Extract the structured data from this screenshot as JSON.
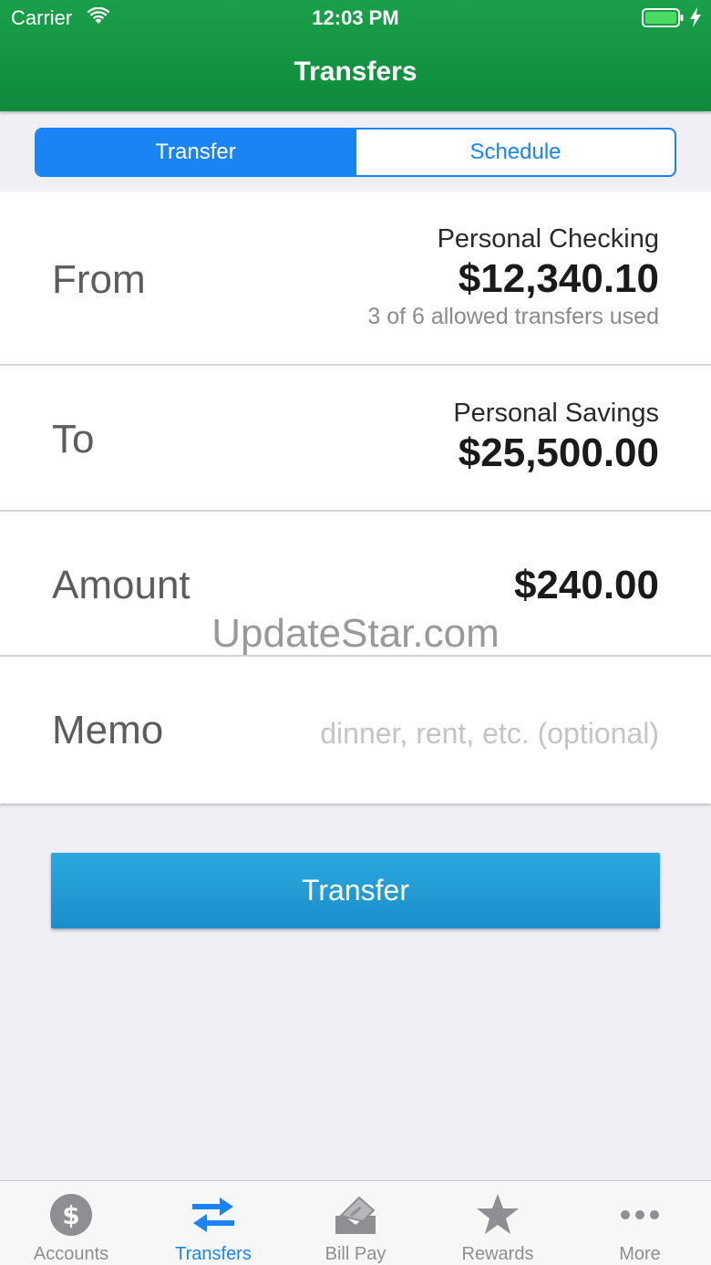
{
  "status_bar": {
    "carrier": "Carrier",
    "time": "12:03 PM"
  },
  "nav": {
    "title": "Transfers"
  },
  "segmented": {
    "transfer": "Transfer",
    "schedule": "Schedule",
    "selected": "Transfer"
  },
  "form": {
    "from": {
      "label": "From",
      "account_name": "Personal Checking",
      "balance": "$12,340.10",
      "note": "3 of 6 allowed transfers used"
    },
    "to": {
      "label": "To",
      "account_name": "Personal Savings",
      "balance": "$25,500.00"
    },
    "amount": {
      "label": "Amount",
      "value": "$240.00"
    },
    "memo": {
      "label": "Memo",
      "placeholder": "dinner, rent, etc. (optional)"
    }
  },
  "watermark": "UpdateStar.com",
  "submit_label": "Transfer",
  "tabs": [
    {
      "label": "Accounts",
      "icon": "dollar-coin-icon",
      "active": false
    },
    {
      "label": "Transfers",
      "icon": "transfer-arrows-icon",
      "active": true
    },
    {
      "label": "Bill Pay",
      "icon": "bill-envelope-icon",
      "active": false
    },
    {
      "label": "Rewards",
      "icon": "star-icon",
      "active": false
    },
    {
      "label": "More",
      "icon": "ellipsis-icon",
      "active": false
    }
  ],
  "colors": {
    "header_green": "#0e8a3c",
    "accent_blue": "#1a84f5",
    "button_blue": "#1b8ec9",
    "inactive_gray": "#8e8e93"
  }
}
